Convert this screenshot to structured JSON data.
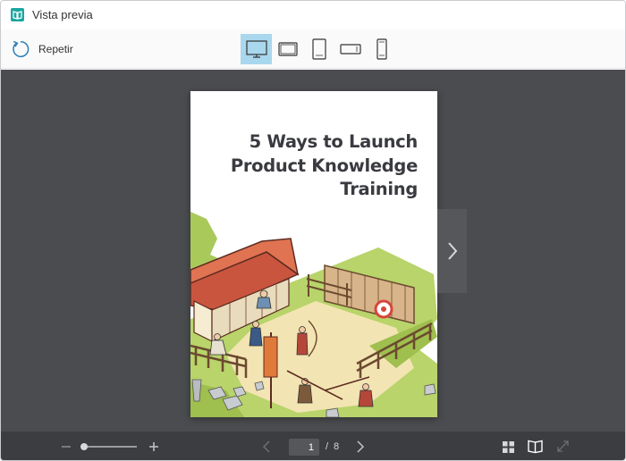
{
  "window": {
    "title": "Vista previa",
    "app_icon": "book-preview-icon"
  },
  "toolbar": {
    "replay_label": "Repetir",
    "replay_icon": "replay-icon",
    "devices": [
      {
        "name": "desktop",
        "icon": "desktop-icon",
        "active": true
      },
      {
        "name": "tablet-landscape",
        "icon": "tablet-landscape-icon",
        "active": false
      },
      {
        "name": "tablet-portrait",
        "icon": "tablet-portrait-icon",
        "active": false
      },
      {
        "name": "phone-landscape",
        "icon": "phone-landscape-icon",
        "active": false
      },
      {
        "name": "phone-portrait",
        "icon": "phone-portrait-icon",
        "active": false
      }
    ],
    "active_color": "#a9d7ee"
  },
  "cover": {
    "title_lines": [
      "5 Ways to Launch",
      "Product Knowledge",
      "Training"
    ]
  },
  "footer": {
    "current_page": "1",
    "separator": "/",
    "total_pages": "8",
    "zoom_fraction": 0.05
  },
  "colors": {
    "stage": "#4a4c4f",
    "footer": "#3b3d40",
    "accent": "#a9d7ee",
    "brand": "#1aa6a0"
  }
}
